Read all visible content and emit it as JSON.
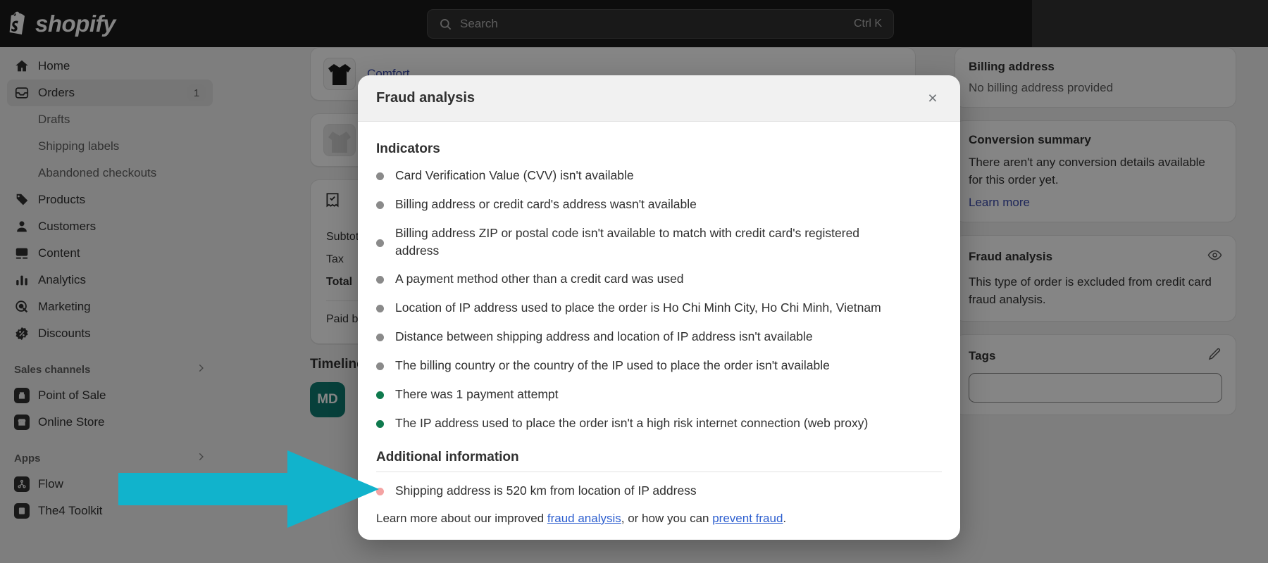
{
  "topbar": {
    "brand_name": "shopify",
    "search": {
      "placeholder": "Search",
      "shortcut": "Ctrl K"
    }
  },
  "sidebar": {
    "items": [
      {
        "label": "Home",
        "icon": "home-icon",
        "badge": ""
      },
      {
        "label": "Orders",
        "icon": "orders-icon",
        "badge": "1"
      },
      {
        "label": "Products",
        "icon": "products-tag-icon",
        "badge": ""
      },
      {
        "label": "Customers",
        "icon": "customers-person-icon",
        "badge": ""
      },
      {
        "label": "Content",
        "icon": "content-image-icon",
        "badge": ""
      },
      {
        "label": "Analytics",
        "icon": "analytics-bars-icon",
        "badge": ""
      },
      {
        "label": "Marketing",
        "icon": "marketing-target-icon",
        "badge": ""
      },
      {
        "label": "Discounts",
        "icon": "discounts-badge-icon",
        "badge": ""
      }
    ],
    "orders_subitems": [
      "Drafts",
      "Shipping labels",
      "Abandoned checkouts"
    ],
    "sections": [
      {
        "title": "Sales channels",
        "items": [
          "Point of Sale",
          "Online Store"
        ]
      },
      {
        "title": "Apps",
        "items": [
          "Flow",
          "The4 Toolkit"
        ]
      }
    ]
  },
  "background": {
    "product_link": "Comfort",
    "totals": {
      "rows": [
        {
          "label": "Subtotal",
          "value": ""
        },
        {
          "label": "Tax",
          "value": ""
        }
      ],
      "total_label": "Total",
      "paid_label": "Paid by customer"
    },
    "timeline_title": "Timeline",
    "timeline_avatar": "MD"
  },
  "right_panel": {
    "billing": {
      "title": "Billing address",
      "body": "No billing address provided"
    },
    "conversion": {
      "title": "Conversion summary",
      "body": "There aren't any conversion details available for this order yet.",
      "link": "Learn more"
    },
    "fraud": {
      "title": "Fraud analysis",
      "body": "This type of order is excluded from credit card fraud analysis.",
      "icon": "eye-icon"
    },
    "tags": {
      "title": "Tags",
      "icon": "pencil-edit-icon",
      "value": ""
    }
  },
  "modal": {
    "title": "Fraud analysis",
    "close_label": "×",
    "indicators_heading": "Indicators",
    "indicators": [
      {
        "text": "Card Verification Value (CVV) isn't available",
        "status": "neutral"
      },
      {
        "text": "Billing address or credit card's address wasn't available",
        "status": "neutral"
      },
      {
        "text": "Billing address ZIP or postal code isn't available to match with credit card's registered address",
        "status": "neutral"
      },
      {
        "text": "A payment method other than a credit card was used",
        "status": "neutral"
      },
      {
        "text": "Location of IP address used to place the order is Ho Chi Minh City, Ho Chi Minh, Vietnam",
        "status": "neutral"
      },
      {
        "text": "Distance between shipping address and location of IP address isn't available",
        "status": "neutral"
      },
      {
        "text": "The billing country or the country of the IP used to place the order isn't available",
        "status": "neutral"
      },
      {
        "text": "There was 1 payment attempt",
        "status": "good"
      },
      {
        "text": "The IP address used to place the order isn't a high risk internet connection (web proxy)",
        "status": "good"
      }
    ],
    "additional_heading": "Additional information",
    "additional": [
      {
        "text": "Shipping address is 520 km from location of IP address",
        "status": "warn"
      }
    ],
    "footer": {
      "prefix": "Learn more about our improved ",
      "link1": "fraud analysis",
      "middle": ", or how you can ",
      "link2": "prevent fraud",
      "suffix": "."
    }
  },
  "colors": {
    "accent_arrow": "#11b3cc",
    "neutral_dot": "#8a8a8a",
    "good_dot": "#0f7a4e",
    "warn_dot": "#f4a3a3",
    "link": "#2c5ecf"
  }
}
